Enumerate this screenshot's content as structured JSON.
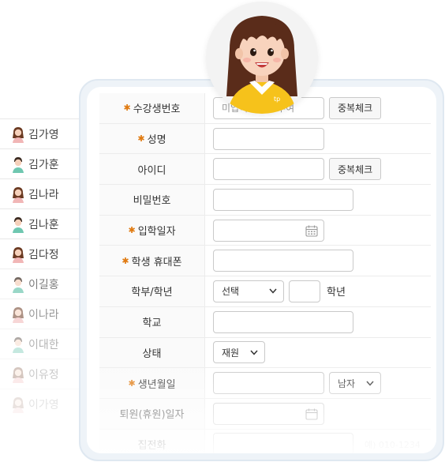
{
  "students": [
    {
      "name": "김가영",
      "gender": "female"
    },
    {
      "name": "김가훈",
      "gender": "male"
    },
    {
      "name": "김나라",
      "gender": "female"
    },
    {
      "name": "김나훈",
      "gender": "male"
    },
    {
      "name": "김다정",
      "gender": "female"
    },
    {
      "name": "이길홍",
      "gender": "male"
    },
    {
      "name": "이나라",
      "gender": "female"
    },
    {
      "name": "이대한",
      "gender": "male"
    },
    {
      "name": "이유정",
      "gender": "female"
    },
    {
      "name": "이가영",
      "gender": "female"
    }
  ],
  "form": {
    "student_no_label": "수강생번호",
    "student_no_placeholder": "미입력시 자동부여",
    "dup_check_label": "중복체크",
    "name_label": "성명",
    "id_label": "아이디",
    "id_dup_check_label": "중복체크",
    "password_label": "비밀번호",
    "enroll_date_label": "입학일자",
    "phone_label": "학생 휴대폰",
    "grade_label": "학부/학년",
    "grade_select": "선택",
    "grade_suffix": "학년",
    "school_label": "학교",
    "status_label": "상태",
    "status_select": "재원",
    "birth_label": "생년월일",
    "gender_select": "남자",
    "leave_date_label": "퇴원(휴원)일자",
    "home_phone_label": "집전화",
    "ghost_text": "예) 010-1234"
  },
  "colors": {
    "accent": "#e07a10",
    "card_border": "#dfe8f1"
  },
  "icons": {
    "calendar": "calendar-icon",
    "chevron": "chevron-down-icon"
  }
}
